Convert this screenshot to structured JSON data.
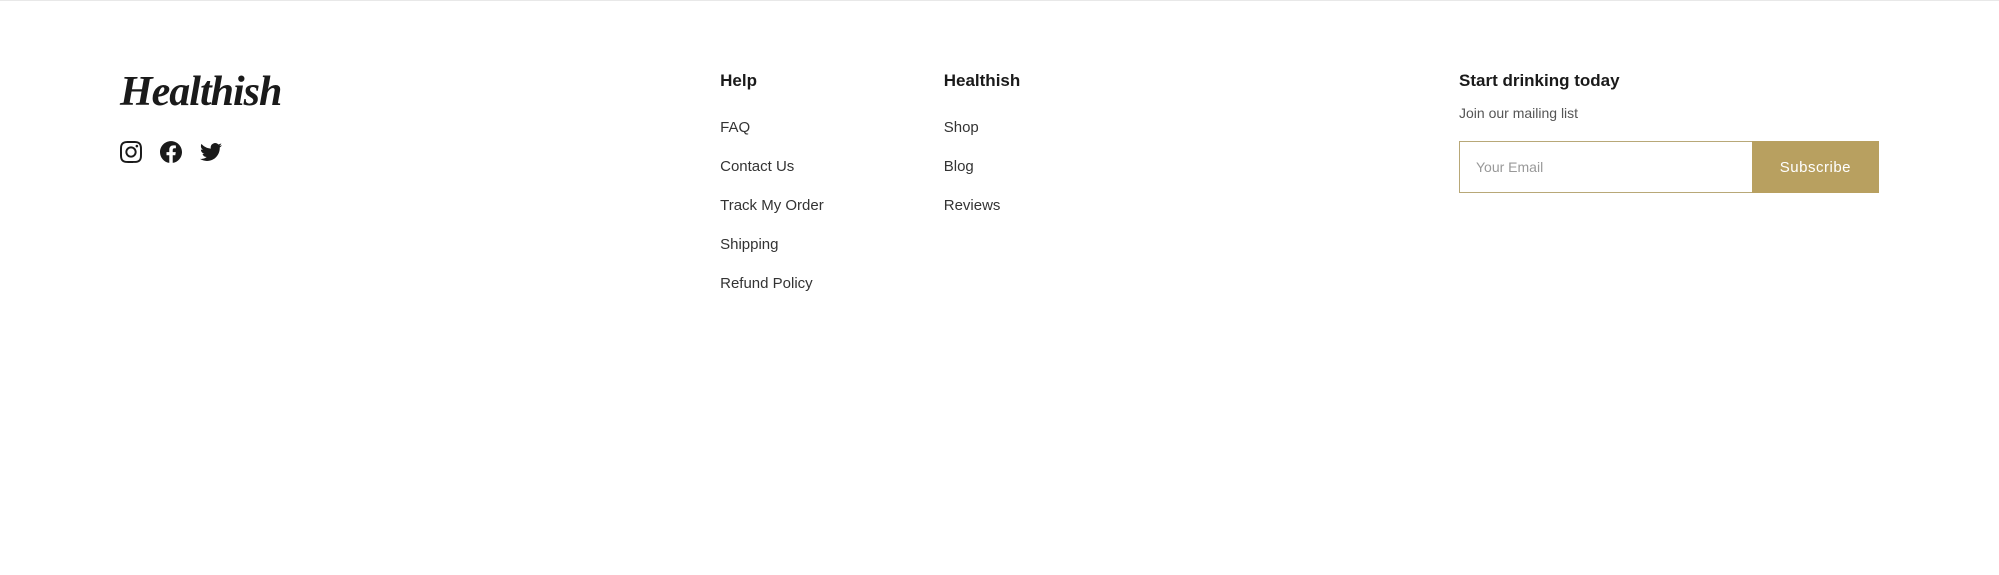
{
  "brand": {
    "logo": "Healthish",
    "colors": {
      "accent": "#b8a060",
      "text": "#1a1a1a"
    }
  },
  "social": {
    "icons": [
      {
        "name": "instagram-icon",
        "label": "Instagram"
      },
      {
        "name": "facebook-icon",
        "label": "Facebook"
      },
      {
        "name": "twitter-icon",
        "label": "Twitter"
      }
    ]
  },
  "nav": {
    "columns": [
      {
        "title": "Help",
        "links": [
          {
            "label": "FAQ",
            "name": "faq-link"
          },
          {
            "label": "Contact Us",
            "name": "contact-link"
          },
          {
            "label": "Track My Order",
            "name": "track-order-link"
          },
          {
            "label": "Shipping",
            "name": "shipping-link"
          },
          {
            "label": "Refund Policy",
            "name": "refund-link"
          }
        ]
      },
      {
        "title": "Healthish",
        "links": [
          {
            "label": "Shop",
            "name": "shop-link"
          },
          {
            "label": "Blog",
            "name": "blog-link"
          },
          {
            "label": "Reviews",
            "name": "reviews-link"
          }
        ]
      }
    ]
  },
  "subscribe": {
    "title": "Start drinking today",
    "subtitle": "Join our mailing list",
    "placeholder": "Your Email",
    "button_label": "Subscribe"
  }
}
